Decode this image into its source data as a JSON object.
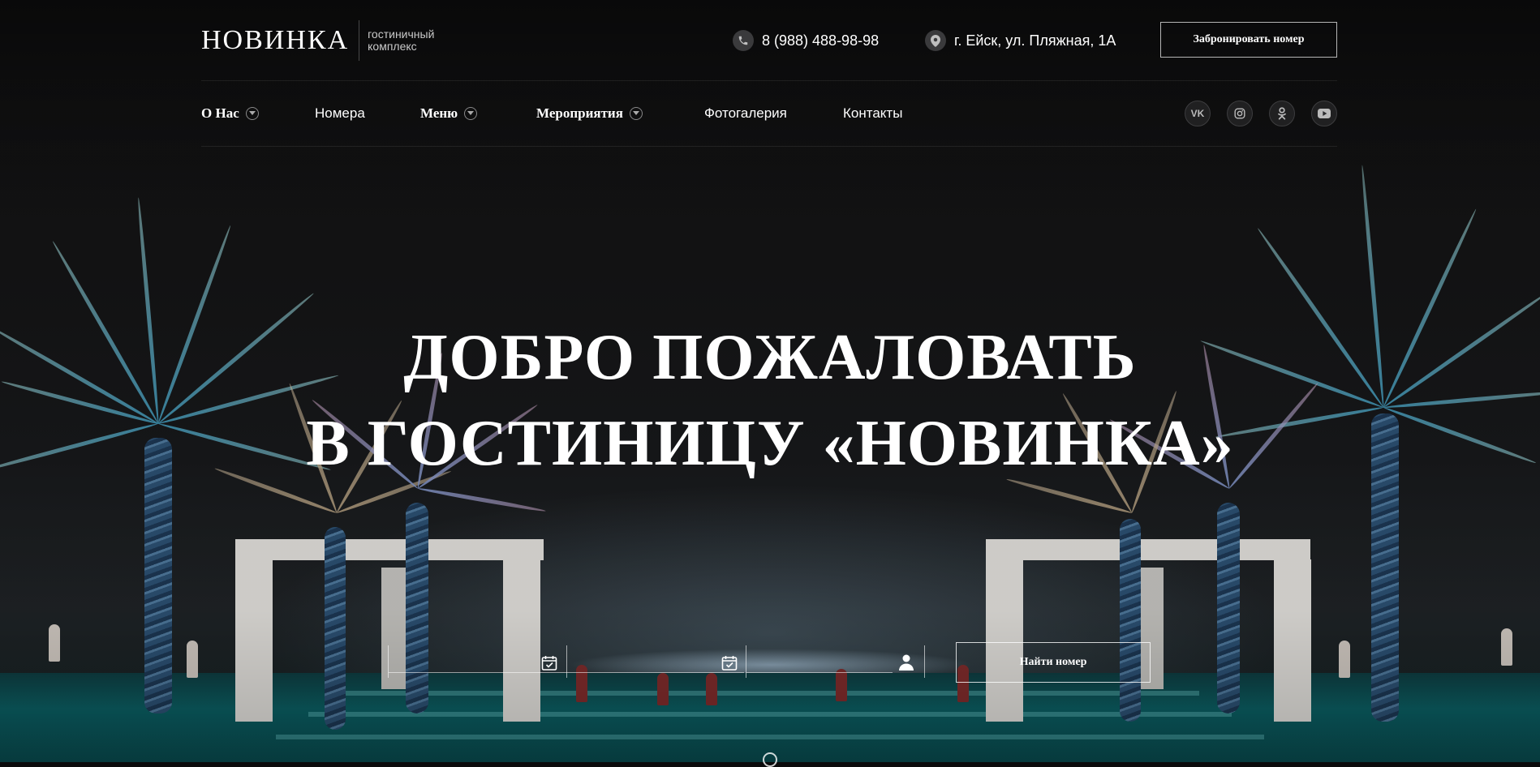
{
  "brand": {
    "name": "НОВИНКА",
    "subtitle_line1": "гостиничный",
    "subtitle_line2": "комплекс"
  },
  "contacts": {
    "phone": "8 (988) 488-98-98",
    "phone_icon": "phone-icon",
    "address": "г. Ейск, ул. Пляжная, 1А",
    "address_icon": "location-pin-icon"
  },
  "book_button": "Забронировать номер",
  "nav": [
    {
      "label": "О Нас",
      "has_dropdown": true
    },
    {
      "label": "Номера",
      "has_dropdown": false
    },
    {
      "label": "Меню",
      "has_dropdown": true
    },
    {
      "label": "Мероприятия",
      "has_dropdown": true
    },
    {
      "label": "Фотогалерия",
      "has_dropdown": false
    },
    {
      "label": "Контакты",
      "has_dropdown": false
    }
  ],
  "social": [
    {
      "name": "vk-icon",
      "glyph": "VK"
    },
    {
      "name": "instagram-icon",
      "glyph": ""
    },
    {
      "name": "odnoklassniki-icon",
      "glyph": ""
    },
    {
      "name": "youtube-icon",
      "glyph": ""
    }
  ],
  "hero": {
    "line1": "ДОБРО ПОЖАЛОВАТЬ",
    "line2": "В ГОСТИНИЦУ «НОВИНКА»"
  },
  "booking": {
    "checkin_icon": "calendar-check-icon",
    "checkout_icon": "calendar-check-icon",
    "guests_icon": "user-icon",
    "find_button": "Найти номер"
  },
  "colors": {
    "background": "#131314",
    "accent": "#ffffff",
    "pool": "#0a5a5e"
  }
}
